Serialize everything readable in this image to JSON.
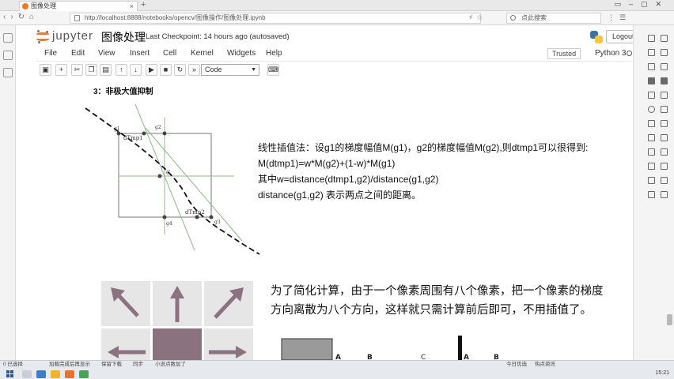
{
  "browser": {
    "tab_title": "图像处理",
    "url": "http://localhost:8888/notebooks/opencv/图像操作/图像处理.ipynb",
    "search_placeholder": "点此搜索"
  },
  "header": {
    "brand": "jupyter",
    "title": "图像处理",
    "checkpoint": "Last Checkpoint: 14 hours ago (autosaved)",
    "logout_label": "Logout"
  },
  "menu": {
    "items": [
      "File",
      "Edit",
      "View",
      "Insert",
      "Cell",
      "Kernel",
      "Widgets",
      "Help"
    ],
    "trusted": "Trusted",
    "kernel": "Python 3"
  },
  "toolbar": {
    "cell_type": "Code"
  },
  "notebook": {
    "section_heading": "3：非极大值抑制",
    "diagram_labels": {
      "dtmp1": "dTmp1",
      "dtmp2": "dTmp2",
      "center": "C",
      "g1": "g1",
      "g2": "g2",
      "g3": "g3",
      "g4": "g4"
    },
    "formula_lines": [
      "线性插值法：设g1的梯度幅值M(g1)，g2的梯度幅值M(g2),则dtmp1可以很得到:",
      "M(dtmp1)=w*M(g2)+(1-w)*M(g1)",
      "其中w=distance(dtmp1,g2)/distance(g1,g2)",
      "distance(g1,g2) 表示两点之间的距离。"
    ],
    "simplify_lines": [
      "为了简化计算，由于一个像素周围有八个像素，把一个像素的梯度",
      "方向离散为八个方向，这样就只需计算前后即可，不用插值了。"
    ],
    "bottom_labels": {
      "a1": "A",
      "b1": "B",
      "c": "C",
      "a2": "A",
      "b2": "B"
    }
  },
  "taskbar": {
    "status_left": "0 已选择",
    "status_items": [
      "加载完成后再显示",
      "保留下载",
      "同步",
      "小说点数加了"
    ],
    "status_right": "今日优选",
    "status_right2": "热点资讯",
    "time": "15:21"
  }
}
